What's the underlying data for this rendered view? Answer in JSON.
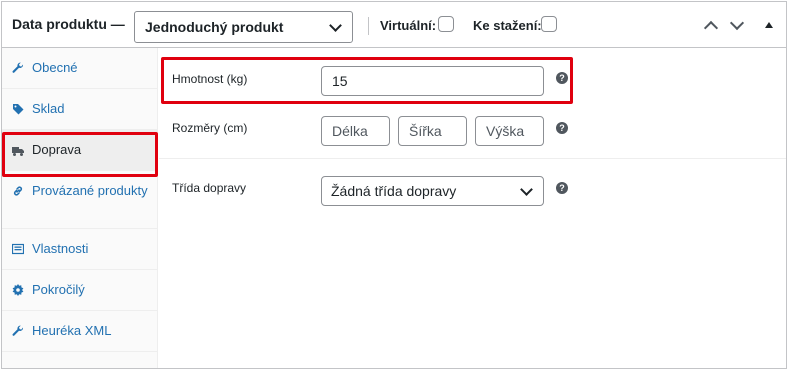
{
  "header": {
    "title": "Data produktu —",
    "product_type": "Jednoduchý produkt",
    "virtual_label": "Virtuální:",
    "downloadable_label": "Ke stažení:"
  },
  "tabs": [
    {
      "label": "Obecné",
      "icon": "wrench-icon"
    },
    {
      "label": "Sklad",
      "icon": "tag-icon"
    },
    {
      "label": "Doprava",
      "icon": "truck-icon",
      "active": true
    },
    {
      "label": "Provázané produkty",
      "icon": "link-icon"
    },
    {
      "label": "Vlastnosti",
      "icon": "list-icon"
    },
    {
      "label": "Pokročilý",
      "icon": "gear-icon"
    },
    {
      "label": "Heuréka XML",
      "icon": "wrench-icon"
    }
  ],
  "shipping": {
    "weight_label": "Hmotnost (kg)",
    "weight_value": "15",
    "dimensions_label": "Rozměry (cm)",
    "length_placeholder": "Délka",
    "width_placeholder": "Šířka",
    "height_placeholder": "Výška",
    "class_label": "Třída dopravy",
    "class_value": "Žádná třída dopravy"
  },
  "colors": {
    "link": "#2271b1",
    "highlight": "#e0000f",
    "border": "#8c8f94"
  }
}
